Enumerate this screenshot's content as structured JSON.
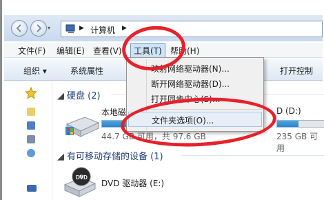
{
  "window": {
    "address_path": "计算机",
    "address_separator": "▶"
  },
  "menubar": {
    "items": [
      "文件(F)",
      "编辑(E)",
      "查看(V)",
      "工具(T)",
      "帮助(H)"
    ]
  },
  "commandbar": {
    "organize": "组织 ▾",
    "system_properties": "系统属性",
    "open_control": "打开控制"
  },
  "dropdown": {
    "items": [
      "映射网络驱动器(N)...",
      "断开网络驱动器(D)...",
      "打开同步中心(S)...",
      "文件夹选项(O)..."
    ]
  },
  "content": {
    "hdd_group": "硬盘 (2)",
    "removable_group": "有可移动存储的设备 (1)",
    "drive_local_name": "本地磁盘",
    "drive_local_free": "44.7 GB 可用，共 97.6 GB",
    "drive_d_name": "D (D:)",
    "drive_d_free": "235 GB 可用",
    "dvd_name": "DVD 驱动器 (E:)",
    "dvd_badge": "DVD"
  },
  "usage": {
    "local_used_fraction": 0.54,
    "d_used_fraction": 0.45
  },
  "colors": {
    "annotation_red": "#e8202a",
    "accent_blue": "#2983c6"
  }
}
